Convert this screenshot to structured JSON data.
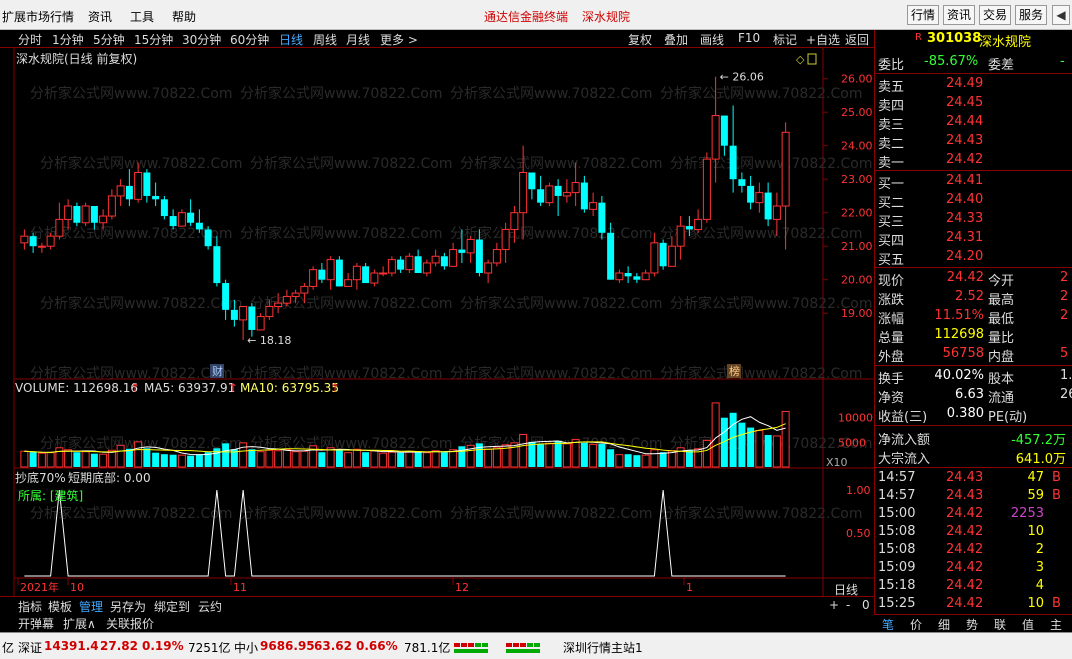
{
  "menubar": {
    "items": [
      "扩展市场行情",
      "资讯",
      "工具",
      "帮助"
    ],
    "promo1": "通达信金融终端",
    "promo2": "深水规院",
    "right_buttons": [
      "行情",
      "资讯",
      "交易",
      "服务"
    ]
  },
  "periodbar": {
    "periods": [
      "分时",
      "1分钟",
      "5分钟",
      "15分钟",
      "30分钟",
      "60分钟",
      "日线",
      "周线",
      "月线",
      "更多 >"
    ],
    "active": "日线",
    "tools": [
      "复权",
      "叠加",
      "画线",
      "F10",
      "标记",
      "+自选",
      "返回"
    ]
  },
  "chart_title": "深水规院(日线 前复权)",
  "chart_data": [
    {
      "type": "candlestick",
      "name": "深水规院",
      "y_ticks": [
        "26.00",
        "25.00",
        "24.00",
        "23.00",
        "22.00",
        "21.00",
        "20.00",
        "19.00"
      ],
      "ylim": [
        18.2,
        26.2
      ],
      "annot_high": "26.06",
      "annot_low": "18.18",
      "markers": [
        "财",
        "榜"
      ],
      "candles": [
        [
          21.1,
          21.5,
          20.9,
          21.3
        ],
        [
          21.3,
          21.4,
          20.8,
          21.0
        ],
        [
          21.0,
          21.1,
          20.8,
          21.0
        ],
        [
          21.0,
          21.4,
          20.9,
          21.3
        ],
        [
          21.3,
          22.3,
          21.2,
          21.8
        ],
        [
          21.8,
          22.4,
          21.5,
          22.2
        ],
        [
          22.2,
          22.3,
          21.6,
          21.7
        ],
        [
          21.7,
          22.3,
          21.6,
          22.2
        ],
        [
          22.2,
          22.1,
          21.5,
          21.7
        ],
        [
          21.7,
          22.1,
          21.5,
          21.9
        ],
        [
          21.9,
          22.7,
          21.8,
          22.5
        ],
        [
          22.5,
          23.0,
          22.2,
          22.8
        ],
        [
          22.8,
          23.3,
          22.2,
          22.4
        ],
        [
          22.4,
          23.5,
          22.3,
          23.2
        ],
        [
          23.2,
          23.3,
          22.3,
          22.5
        ],
        [
          22.5,
          22.9,
          22.2,
          22.4
        ],
        [
          22.4,
          22.5,
          21.8,
          21.9
        ],
        [
          21.9,
          22.1,
          21.5,
          21.6
        ],
        [
          21.6,
          22.1,
          21.6,
          22.0
        ],
        [
          22.0,
          22.4,
          21.6,
          21.7
        ],
        [
          21.7,
          22.1,
          21.4,
          21.5
        ],
        [
          21.5,
          21.6,
          20.9,
          21.0
        ],
        [
          21.0,
          21.3,
          19.8,
          19.9
        ],
        [
          19.9,
          20.0,
          18.8,
          19.1
        ],
        [
          19.1,
          19.4,
          18.6,
          18.8
        ],
        [
          18.8,
          19.2,
          18.2,
          19.2
        ],
        [
          19.2,
          19.3,
          18.3,
          18.5
        ],
        [
          18.5,
          19.0,
          18.5,
          18.9
        ],
        [
          18.9,
          19.4,
          18.8,
          19.2
        ],
        [
          19.2,
          19.6,
          19.0,
          19.3
        ],
        [
          19.3,
          19.7,
          19.2,
          19.5
        ],
        [
          19.5,
          19.7,
          19.3,
          19.6
        ],
        [
          19.6,
          19.9,
          19.3,
          19.8
        ],
        [
          19.8,
          20.4,
          19.7,
          20.3
        ],
        [
          20.3,
          20.5,
          19.9,
          20.0
        ],
        [
          20.0,
          20.7,
          19.7,
          20.6
        ],
        [
          20.6,
          20.7,
          19.8,
          19.8
        ],
        [
          19.8,
          20.2,
          19.8,
          20.0
        ],
        [
          20.0,
          20.5,
          19.7,
          20.4
        ],
        [
          20.4,
          20.5,
          19.9,
          19.9
        ],
        [
          19.9,
          20.3,
          19.8,
          20.2
        ],
        [
          20.2,
          20.4,
          20.1,
          20.2
        ],
        [
          20.2,
          20.7,
          20.1,
          20.6
        ],
        [
          20.6,
          20.7,
          20.2,
          20.3
        ],
        [
          20.3,
          20.8,
          20.2,
          20.7
        ],
        [
          20.7,
          20.9,
          20.2,
          20.2
        ],
        [
          20.2,
          20.6,
          20.1,
          20.5
        ],
        [
          20.5,
          20.9,
          20.4,
          20.7
        ],
        [
          20.7,
          20.8,
          20.3,
          20.4
        ],
        [
          20.4,
          21.1,
          20.4,
          20.9
        ],
        [
          20.9,
          21.5,
          20.5,
          20.8
        ],
        [
          20.8,
          21.3,
          20.5,
          21.2
        ],
        [
          21.2,
          21.5,
          20.1,
          20.2
        ],
        [
          20.2,
          20.6,
          19.9,
          20.5
        ],
        [
          20.5,
          21.1,
          20.4,
          20.9
        ],
        [
          20.9,
          21.7,
          20.5,
          21.5
        ],
        [
          21.5,
          22.2,
          21.1,
          22.0
        ],
        [
          22.0,
          24.0,
          21.2,
          23.2
        ],
        [
          23.2,
          23.2,
          22.4,
          22.7
        ],
        [
          22.7,
          23.1,
          22.2,
          22.3
        ],
        [
          22.3,
          22.9,
          22.2,
          22.8
        ],
        [
          22.8,
          23.0,
          21.9,
          22.5
        ],
        [
          22.5,
          23.0,
          22.3,
          22.6
        ],
        [
          22.6,
          23.5,
          22.2,
          22.9
        ],
        [
          22.9,
          23.1,
          22.0,
          22.1
        ],
        [
          22.1,
          22.6,
          21.9,
          22.3
        ],
        [
          22.3,
          22.5,
          21.2,
          21.4
        ],
        [
          21.4,
          21.7,
          20.0,
          20.0
        ],
        [
          20.0,
          20.3,
          19.9,
          20.2
        ],
        [
          20.2,
          20.4,
          19.9,
          20.1
        ],
        [
          20.1,
          20.2,
          19.9,
          20.0
        ],
        [
          20.0,
          20.3,
          20.0,
          20.2
        ],
        [
          20.2,
          21.4,
          20.1,
          21.1
        ],
        [
          21.1,
          21.2,
          20.3,
          20.4
        ],
        [
          20.4,
          21.3,
          20.4,
          21.0
        ],
        [
          21.0,
          21.9,
          20.6,
          21.6
        ],
        [
          21.6,
          21.9,
          21.3,
          21.5
        ],
        [
          21.5,
          22.1,
          21.4,
          21.8
        ],
        [
          21.8,
          23.8,
          21.7,
          23.6
        ],
        [
          23.6,
          26.06,
          22.9,
          24.9
        ],
        [
          24.9,
          24.7,
          23.7,
          24.0
        ],
        [
          24.0,
          25.2,
          22.6,
          23.0
        ],
        [
          23.0,
          23.2,
          22.6,
          22.8
        ],
        [
          22.8,
          23.1,
          22.1,
          22.3
        ],
        [
          22.3,
          22.9,
          22.0,
          22.6
        ],
        [
          22.6,
          22.9,
          21.6,
          21.8
        ],
        [
          21.8,
          22.6,
          21.3,
          22.2
        ],
        [
          22.2,
          24.7,
          20.9,
          24.4
        ]
      ]
    },
    {
      "type": "bar",
      "name": "VOLUME",
      "label": "VOLUME: 112698.16",
      "ma5_label": "MA5: 63937.91",
      "ma10_label": "MA10: 63795.35",
      "y_ticks": [
        "10000",
        "5000"
      ],
      "unit_tag": "X10",
      "values": [
        3200,
        3000,
        2800,
        2900,
        3900,
        3500,
        3000,
        3100,
        2700,
        2600,
        3400,
        4400,
        3700,
        5100,
        3800,
        2900,
        2600,
        2500,
        2400,
        2300,
        2600,
        3000,
        3800,
        4800,
        3600,
        4900,
        3600,
        3100,
        3400,
        3300,
        3500,
        3100,
        3200,
        4300,
        3000,
        3900,
        3600,
        2900,
        3600,
        3000,
        3300,
        2800,
        3000,
        2900,
        3200,
        3200,
        2900,
        3300,
        3000,
        3500,
        4200,
        4400,
        4800,
        3600,
        3900,
        4500,
        4900,
        6600,
        5100,
        4600,
        4800,
        5300,
        4700,
        5600,
        4900,
        4600,
        4700,
        3600,
        2500,
        2600,
        2400,
        2400,
        3500,
        3000,
        3300,
        3900,
        3400,
        3700,
        5400,
        13000,
        10000,
        11000,
        9000,
        8000,
        7400,
        6500,
        6300,
        11269.8
      ]
    },
    {
      "type": "line",
      "name": "抄底70%",
      "label": "抄底70%",
      "series_label": "短期底部: 0.00",
      "category_label": "所属: [建筑]",
      "y_ticks": [
        "1.00",
        "0.50"
      ],
      "values": [
        0,
        0,
        0,
        0,
        1,
        0,
        0,
        0,
        0,
        0,
        0,
        0,
        0,
        0,
        0,
        0,
        0,
        0,
        0,
        0,
        0,
        0,
        1,
        0,
        0,
        1,
        0,
        0,
        0,
        0,
        0,
        0,
        0,
        0,
        0,
        0,
        0,
        0,
        0,
        0,
        0,
        0,
        0,
        0,
        0,
        0,
        0,
        0,
        0,
        0,
        0,
        0,
        0,
        0,
        0,
        0,
        0,
        0,
        0,
        0,
        0,
        0,
        0,
        0,
        0,
        0,
        0,
        0,
        0,
        0,
        0,
        0,
        0,
        1,
        0,
        0,
        0,
        0,
        0,
        0,
        0,
        0,
        0,
        0,
        0,
        0,
        0,
        0
      ]
    }
  ],
  "xaxis": {
    "labels": [
      "2021年",
      "10",
      "11",
      "12",
      "1"
    ],
    "period": "日线",
    "zoom": [
      "+",
      "-",
      "0"
    ]
  },
  "watermark": "分析家公式网www.70822.Com",
  "bottom_tabs": [
    "指标",
    "模板",
    "管理",
    "另存为",
    "绑定到",
    "云约"
  ],
  "bottom_tabs2": [
    "开弹幕",
    "扩展∧",
    "关联报价"
  ],
  "quote": {
    "code": "301038",
    "name": "深水规院",
    "wb_label": "委比",
    "wb_val": "-85.67%",
    "wc_label": "委差",
    "wc_val": "-",
    "asks": [
      {
        "label": "卖五",
        "price": "24.49"
      },
      {
        "label": "卖四",
        "price": "24.45"
      },
      {
        "label": "卖三",
        "price": "24.44"
      },
      {
        "label": "卖二",
        "price": "24.43"
      },
      {
        "label": "卖一",
        "price": "24.42"
      }
    ],
    "bids": [
      {
        "label": "买一",
        "price": "24.41"
      },
      {
        "label": "买二",
        "price": "24.40"
      },
      {
        "label": "买三",
        "price": "24.33"
      },
      {
        "label": "买四",
        "price": "24.31"
      },
      {
        "label": "买五",
        "price": "24.20"
      }
    ],
    "stats": [
      {
        "l": "现价",
        "v": "24.42",
        "c": "#ff3333",
        "l2": "今开",
        "v2": "2"
      },
      {
        "l": "涨跌",
        "v": "2.52",
        "c": "#ff3333",
        "l2": "最高",
        "v2": "2"
      },
      {
        "l": "涨幅",
        "v": "11.51%",
        "c": "#ff3333",
        "l2": "最低",
        "v2": "2"
      },
      {
        "l": "总量",
        "v": "112698",
        "c": "#ffff00",
        "l2": "量比",
        "v2": ""
      },
      {
        "l": "外盘",
        "v": "56758",
        "c": "#ff3333",
        "l2": "内盘",
        "v2": "5"
      }
    ],
    "stats2": [
      {
        "l": "换手",
        "v": "40.02%",
        "c": "#ffffff",
        "l2": "股本",
        "v2": "1."
      },
      {
        "l": "净资",
        "v": "6.63",
        "c": "#ffffff",
        "l2": "流通",
        "v2": "26"
      },
      {
        "l": "收益(三)",
        "v": "0.380",
        "c": "#ffffff",
        "l2": "PE(动)",
        "v2": ""
      }
    ],
    "net_inflow_label": "净流入额",
    "net_inflow": "-457.2万",
    "block_inflow_label": "大宗流入",
    "block_inflow": "641.0万",
    "ticks": [
      {
        "t": "14:57",
        "p": "24.43",
        "v": "47",
        "s": "B",
        "vc": "#ffff00",
        "sc": "#ff3333"
      },
      {
        "t": "14:57",
        "p": "24.43",
        "v": "59",
        "s": "B",
        "vc": "#ffff00",
        "sc": "#ff3333"
      },
      {
        "t": "15:00",
        "p": "24.42",
        "v": "2253",
        "s": "",
        "vc": "#cc44cc",
        "sc": "#ff3333"
      },
      {
        "t": "15:08",
        "p": "24.42",
        "v": "10",
        "s": "",
        "vc": "#ffff00",
        "sc": "#ff3333"
      },
      {
        "t": "15:08",
        "p": "24.42",
        "v": "2",
        "s": "",
        "vc": "#ffff00",
        "sc": "#ff3333"
      },
      {
        "t": "15:09",
        "p": "24.42",
        "v": "3",
        "s": "",
        "vc": "#ffff00",
        "sc": "#ff3333"
      },
      {
        "t": "15:18",
        "p": "24.42",
        "v": "4",
        "s": "",
        "vc": "#ffff00",
        "sc": "#ff3333"
      },
      {
        "t": "15:25",
        "p": "24.42",
        "v": "10",
        "s": "B",
        "vc": "#ffff00",
        "sc": "#ff3333"
      }
    ],
    "tabs": [
      "笔",
      "价",
      "细",
      "势",
      "联",
      "值",
      "主"
    ]
  },
  "statusbar": {
    "lead": "亿",
    "sz_label": "深证",
    "sz_val": "14391.4",
    "sz_chg": "27.82",
    "sz_pct": "0.19%",
    "sz_amt": "7251亿",
    "zx_label": "中小",
    "zx_val": "9686.95",
    "zx_chg": "63.62",
    "zx_pct": "0.66%",
    "zx_amt": "781.1亿",
    "server": "深圳行情主站1"
  }
}
